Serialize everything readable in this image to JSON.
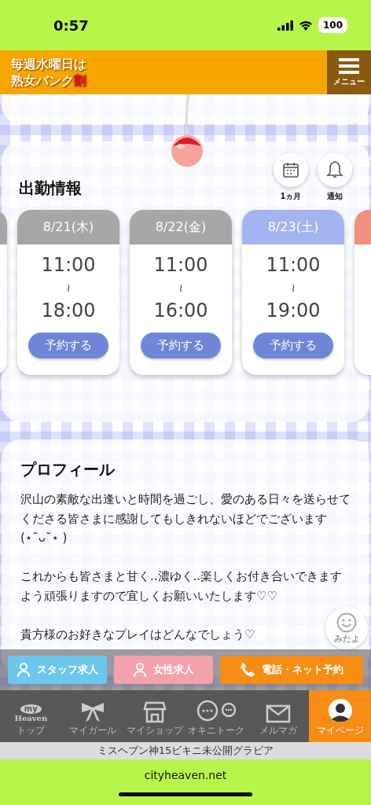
{
  "status_bar": {
    "time": "0:57",
    "battery": "100"
  },
  "header": {
    "logo_lines": [
      "毎週水曜日は",
      "熟女バンク"
    ],
    "logo_accent": "割",
    "menu_label": "メニュー"
  },
  "schedule": {
    "title": "出勤情報",
    "tools": [
      {
        "kind": "calendar",
        "label": "1ヵ月"
      },
      {
        "kind": "bell",
        "label": "通知"
      }
    ],
    "days": [
      {
        "date": "8/21(木)",
        "color": "#a6a6a6",
        "start": "11:00",
        "sep": "≀",
        "end": "18:00",
        "button": "予約する"
      },
      {
        "date": "8/22(金)",
        "color": "#a6a6a6",
        "start": "11:00",
        "sep": "≀",
        "end": "16:00",
        "button": "予約する"
      },
      {
        "date": "8/23(土)",
        "color": "#a4b4f0",
        "start": "11:00",
        "sep": "≀",
        "end": "19:00",
        "button": "予約する"
      }
    ]
  },
  "profile": {
    "title": "プロフィール",
    "paragraphs": [
      "沢山の素敵な出逢いと時間を過ごし、愛のある日々を送らせてくださる皆さまに感謝してもしきれないほどでございます(⋆˘ᴗ˘⋆ )",
      "これからも皆さまと甘く..濃ゆく..楽しくお付き合いできますよう頑張りますので宜しくお願いいたします♡♡",
      "貴方様のお好きなプレイはどんなでしょう♡"
    ]
  },
  "mitayo": {
    "label": "みたよ"
  },
  "actions": [
    {
      "kind": "staff",
      "label": "スタッフ求人"
    },
    {
      "kind": "women",
      "label": "女性求人"
    },
    {
      "kind": "phone",
      "label": "電話・ネット予約"
    }
  ],
  "nav": [
    {
      "kind": "myheaven",
      "logo": [
        "my",
        "Heaven"
      ],
      "label": "トップ",
      "selected": false
    },
    {
      "kind": "bow",
      "label": "マイガール",
      "selected": false
    },
    {
      "kind": "shop",
      "label": "マイショップ",
      "selected": false
    },
    {
      "kind": "chat",
      "label": "オキニトーク",
      "selected": false
    },
    {
      "kind": "mail",
      "label": "メルマガ",
      "selected": false
    },
    {
      "kind": "avatar",
      "label": "マイページ",
      "selected": true
    }
  ],
  "ticker": "ミスヘブン神15ビキニ未公開グラビア",
  "browser": {
    "url": "cityheaven.net"
  }
}
